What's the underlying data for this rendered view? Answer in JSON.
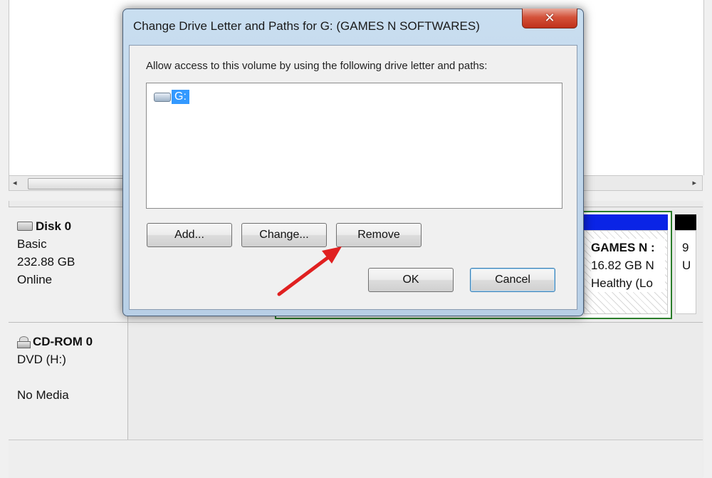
{
  "dialog": {
    "title": "Change Drive Letter and Paths for G: (GAMES N SOFTWARES)",
    "close_glyph": "✕",
    "instruction": "Allow access to this volume by using the following drive letter and paths:",
    "paths": [
      {
        "label": "G:",
        "icon": "drive-icon",
        "selected": true
      }
    ],
    "buttons": {
      "add": "Add...",
      "change": "Change...",
      "remove": "Remove",
      "ok": "OK",
      "cancel": "Cancel"
    }
  },
  "background": {
    "scroll_left": "◂",
    "scroll_right": "▸",
    "disk0": {
      "name": "Disk 0",
      "type": "Basic",
      "size": "232.88 GB",
      "status": "Online"
    },
    "cdrom0": {
      "name": "CD-ROM 0",
      "type": "DVD (H:)",
      "media": "No Media"
    },
    "partition_g": {
      "name": "GAMES N :",
      "size": "16.82 GB N",
      "status": "Healthy (Lo"
    },
    "partition_last": {
      "size": "9",
      "status": "U"
    }
  },
  "colors": {
    "partition_header": "#0a24e6",
    "partition_border": "#2b7d2b",
    "selection": "#3399ff",
    "annotation_arrow": "#e02020"
  }
}
